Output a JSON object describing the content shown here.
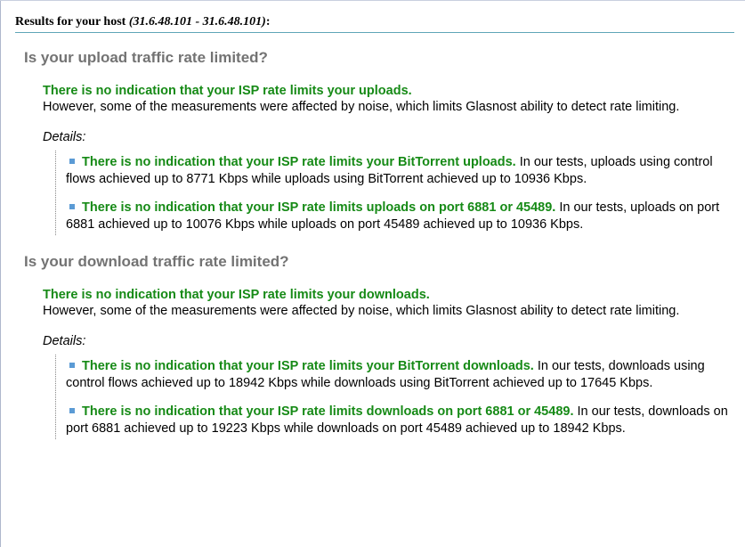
{
  "header": {
    "prefix": "Results for your host ",
    "host": "(31.6.48.101 - 31.6.48.101)",
    "suffix": ":"
  },
  "upload": {
    "title": "Is your upload traffic rate limited?",
    "summary_headline": "There is no indication that your ISP rate limits your uploads.",
    "summary_text": "However, some of the measurements were affected by noise, which limits Glasnost ability to detect rate limiting.",
    "details_label": "Details:",
    "items": [
      {
        "headline": "There is no indication that your ISP rate limits your BitTorrent uploads.",
        "text": " In our tests, uploads using control flows achieved up to 8771 Kbps while uploads using BitTorrent achieved up to 10936 Kbps."
      },
      {
        "headline": "There is no indication that your ISP rate limits uploads on port 6881 or 45489.",
        "text": " In our tests, uploads on port 6881 achieved up to 10076 Kbps while uploads on port 45489 achieved up to 10936 Kbps."
      }
    ]
  },
  "download": {
    "title": "Is your download traffic rate limited?",
    "summary_headline": "There is no indication that your ISP rate limits your downloads.",
    "summary_text": "However, some of the measurements were affected by noise, which limits Glasnost ability to detect rate limiting.",
    "details_label": "Details:",
    "items": [
      {
        "headline": "There is no indication that your ISP rate limits your BitTorrent downloads.",
        "text": " In our tests, downloads using control flows achieved up to 18942 Kbps while downloads using BitTorrent achieved up to 17645 Kbps."
      },
      {
        "headline": "There is no indication that your ISP rate limits downloads on port 6881 or 45489.",
        "text": " In our tests, downloads on port 6881 achieved up to 19223 Kbps while downloads on port 45489 achieved up to 18942 Kbps."
      }
    ]
  },
  "colors": {
    "headline_green": "#168a16",
    "section_title_gray": "#737373",
    "bullet_blue": "#5b9bd5",
    "header_rule": "#5fa6b8"
  }
}
